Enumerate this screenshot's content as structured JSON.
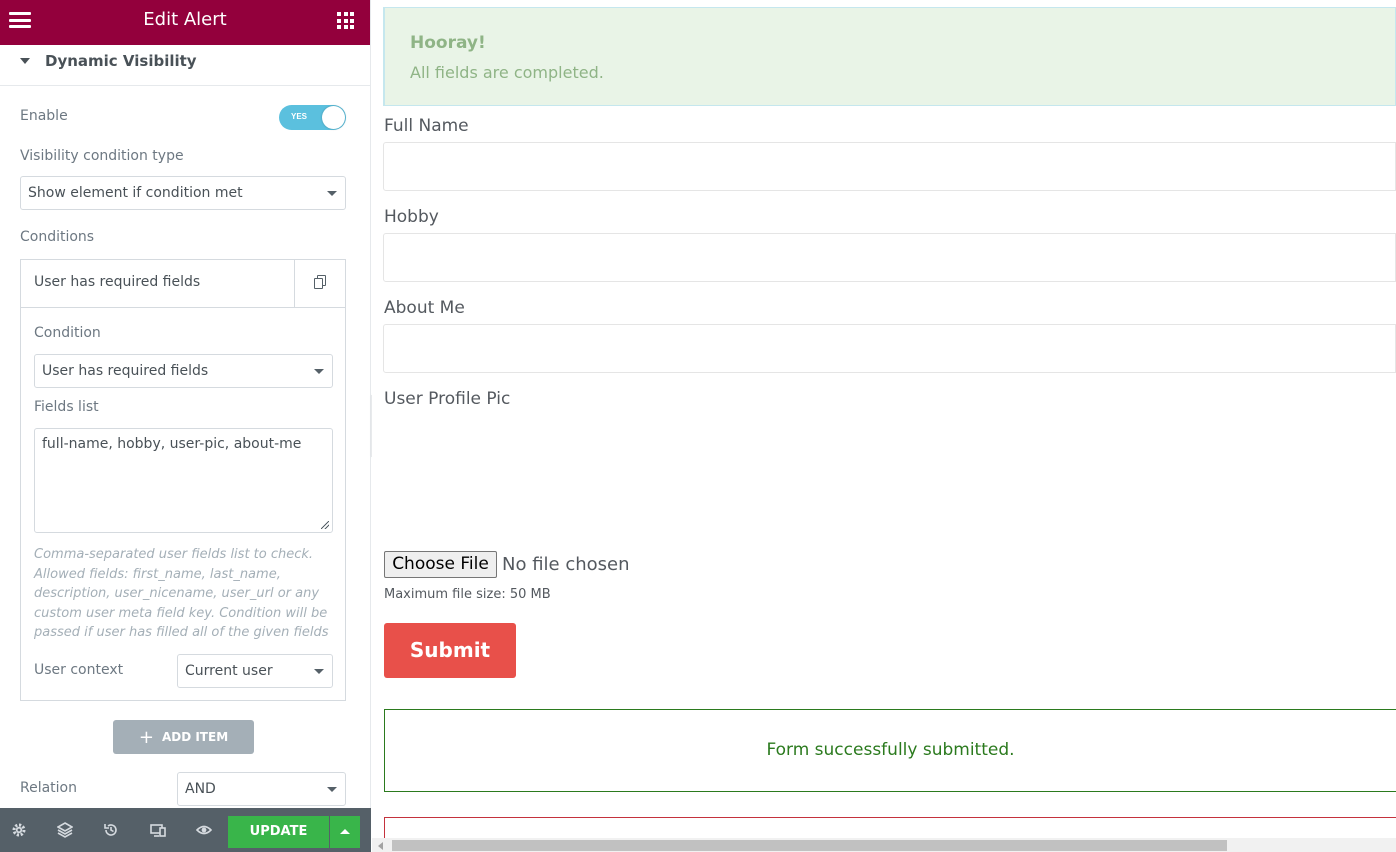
{
  "topbar": {
    "title": "Edit Alert",
    "menu_icon": "hamburger-menu-icon",
    "widgets_icon": "apps-grid-icon",
    "color": "#93003c"
  },
  "section": {
    "title": "Dynamic Visibility"
  },
  "enable": {
    "label": "Enable",
    "toggle_text": "YES",
    "state": true,
    "color": "#5bc0de"
  },
  "visibility_type": {
    "label": "Visibility condition type",
    "value": "Show element if condition met"
  },
  "conditions": {
    "label": "Conditions",
    "item": {
      "title": "User has required fields",
      "condition_label": "Condition",
      "condition_value": "User has required fields",
      "fields_label": "Fields list",
      "fields_value": "full-name, hobby, user-pic, about-me",
      "hint": "Comma-separated user fields list to check. Allowed fields: first_name, last_name, description, user_nicename, user_url or any custom user meta field key. Condition will be passed if user has filled all of the given fields",
      "context_label": "User context",
      "context_value": "Current user"
    },
    "add_item_label": "ADD ITEM"
  },
  "relation": {
    "label": "Relation",
    "value": "AND"
  },
  "footer": {
    "update_label": "UPDATE",
    "update_color": "#39b54a",
    "icons": [
      "settings-icon",
      "navigator-layers-icon",
      "history-icon",
      "responsive-mode-icon",
      "preview-eye-icon"
    ]
  },
  "preview": {
    "alert_title": "Hooray!",
    "alert_text": "All fields are completed.",
    "fields": [
      {
        "label": "Full Name"
      },
      {
        "label": "Hobby"
      },
      {
        "label": "About Me"
      }
    ],
    "pic_label": "User Profile Pic",
    "file_button": "Choose File",
    "file_status": "No file chosen",
    "max_size": "Maximum file size: 50 MB",
    "submit_label": "Submit",
    "submit_color": "#e8504a",
    "success_message": "Form successfully submitted.",
    "success_color": "#2b7a1e"
  }
}
